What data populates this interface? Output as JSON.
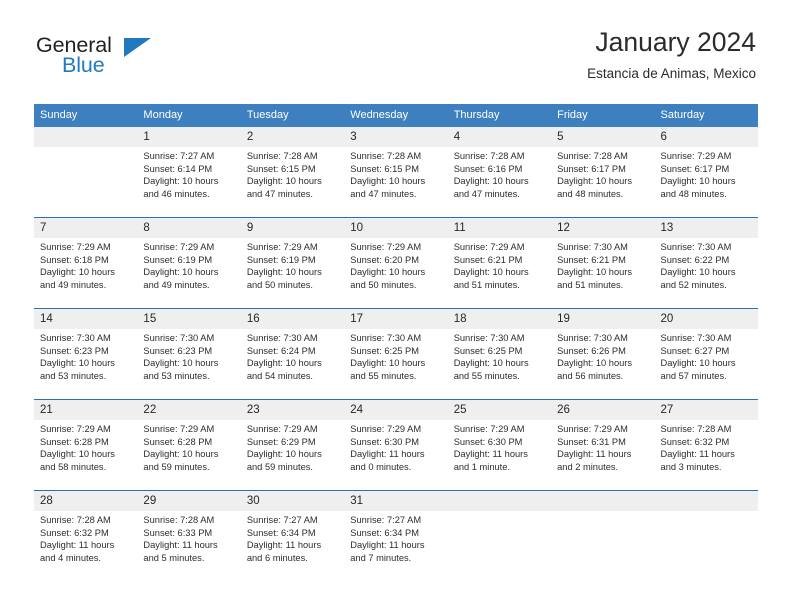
{
  "logo": {
    "word_one": "General",
    "word_two": "Blue",
    "triangle": "triangle-icon",
    "accent_color": "#2179bf"
  },
  "header": {
    "title": "January 2024",
    "subtitle": "Estancia de Animas, Mexico"
  },
  "calendar": {
    "header_bg": "#3d7fbf",
    "daynum_bg": "#efefef",
    "weekday_headers": [
      "Sunday",
      "Monday",
      "Tuesday",
      "Wednesday",
      "Thursday",
      "Friday",
      "Saturday"
    ],
    "weeks": [
      [
        {
          "day": "",
          "sunrise": "",
          "sunset": "",
          "daylight1": "",
          "daylight2": ""
        },
        {
          "day": "1",
          "sunrise": "Sunrise: 7:27 AM",
          "sunset": "Sunset: 6:14 PM",
          "daylight1": "Daylight: 10 hours",
          "daylight2": "and 46 minutes."
        },
        {
          "day": "2",
          "sunrise": "Sunrise: 7:28 AM",
          "sunset": "Sunset: 6:15 PM",
          "daylight1": "Daylight: 10 hours",
          "daylight2": "and 47 minutes."
        },
        {
          "day": "3",
          "sunrise": "Sunrise: 7:28 AM",
          "sunset": "Sunset: 6:15 PM",
          "daylight1": "Daylight: 10 hours",
          "daylight2": "and 47 minutes."
        },
        {
          "day": "4",
          "sunrise": "Sunrise: 7:28 AM",
          "sunset": "Sunset: 6:16 PM",
          "daylight1": "Daylight: 10 hours",
          "daylight2": "and 47 minutes."
        },
        {
          "day": "5",
          "sunrise": "Sunrise: 7:28 AM",
          "sunset": "Sunset: 6:17 PM",
          "daylight1": "Daylight: 10 hours",
          "daylight2": "and 48 minutes."
        },
        {
          "day": "6",
          "sunrise": "Sunrise: 7:29 AM",
          "sunset": "Sunset: 6:17 PM",
          "daylight1": "Daylight: 10 hours",
          "daylight2": "and 48 minutes."
        }
      ],
      [
        {
          "day": "7",
          "sunrise": "Sunrise: 7:29 AM",
          "sunset": "Sunset: 6:18 PM",
          "daylight1": "Daylight: 10 hours",
          "daylight2": "and 49 minutes."
        },
        {
          "day": "8",
          "sunrise": "Sunrise: 7:29 AM",
          "sunset": "Sunset: 6:19 PM",
          "daylight1": "Daylight: 10 hours",
          "daylight2": "and 49 minutes."
        },
        {
          "day": "9",
          "sunrise": "Sunrise: 7:29 AM",
          "sunset": "Sunset: 6:19 PM",
          "daylight1": "Daylight: 10 hours",
          "daylight2": "and 50 minutes."
        },
        {
          "day": "10",
          "sunrise": "Sunrise: 7:29 AM",
          "sunset": "Sunset: 6:20 PM",
          "daylight1": "Daylight: 10 hours",
          "daylight2": "and 50 minutes."
        },
        {
          "day": "11",
          "sunrise": "Sunrise: 7:29 AM",
          "sunset": "Sunset: 6:21 PM",
          "daylight1": "Daylight: 10 hours",
          "daylight2": "and 51 minutes."
        },
        {
          "day": "12",
          "sunrise": "Sunrise: 7:30 AM",
          "sunset": "Sunset: 6:21 PM",
          "daylight1": "Daylight: 10 hours",
          "daylight2": "and 51 minutes."
        },
        {
          "day": "13",
          "sunrise": "Sunrise: 7:30 AM",
          "sunset": "Sunset: 6:22 PM",
          "daylight1": "Daylight: 10 hours",
          "daylight2": "and 52 minutes."
        }
      ],
      [
        {
          "day": "14",
          "sunrise": "Sunrise: 7:30 AM",
          "sunset": "Sunset: 6:23 PM",
          "daylight1": "Daylight: 10 hours",
          "daylight2": "and 53 minutes."
        },
        {
          "day": "15",
          "sunrise": "Sunrise: 7:30 AM",
          "sunset": "Sunset: 6:23 PM",
          "daylight1": "Daylight: 10 hours",
          "daylight2": "and 53 minutes."
        },
        {
          "day": "16",
          "sunrise": "Sunrise: 7:30 AM",
          "sunset": "Sunset: 6:24 PM",
          "daylight1": "Daylight: 10 hours",
          "daylight2": "and 54 minutes."
        },
        {
          "day": "17",
          "sunrise": "Sunrise: 7:30 AM",
          "sunset": "Sunset: 6:25 PM",
          "daylight1": "Daylight: 10 hours",
          "daylight2": "and 55 minutes."
        },
        {
          "day": "18",
          "sunrise": "Sunrise: 7:30 AM",
          "sunset": "Sunset: 6:25 PM",
          "daylight1": "Daylight: 10 hours",
          "daylight2": "and 55 minutes."
        },
        {
          "day": "19",
          "sunrise": "Sunrise: 7:30 AM",
          "sunset": "Sunset: 6:26 PM",
          "daylight1": "Daylight: 10 hours",
          "daylight2": "and 56 minutes."
        },
        {
          "day": "20",
          "sunrise": "Sunrise: 7:30 AM",
          "sunset": "Sunset: 6:27 PM",
          "daylight1": "Daylight: 10 hours",
          "daylight2": "and 57 minutes."
        }
      ],
      [
        {
          "day": "21",
          "sunrise": "Sunrise: 7:29 AM",
          "sunset": "Sunset: 6:28 PM",
          "daylight1": "Daylight: 10 hours",
          "daylight2": "and 58 minutes."
        },
        {
          "day": "22",
          "sunrise": "Sunrise: 7:29 AM",
          "sunset": "Sunset: 6:28 PM",
          "daylight1": "Daylight: 10 hours",
          "daylight2": "and 59 minutes."
        },
        {
          "day": "23",
          "sunrise": "Sunrise: 7:29 AM",
          "sunset": "Sunset: 6:29 PM",
          "daylight1": "Daylight: 10 hours",
          "daylight2": "and 59 minutes."
        },
        {
          "day": "24",
          "sunrise": "Sunrise: 7:29 AM",
          "sunset": "Sunset: 6:30 PM",
          "daylight1": "Daylight: 11 hours",
          "daylight2": "and 0 minutes."
        },
        {
          "day": "25",
          "sunrise": "Sunrise: 7:29 AM",
          "sunset": "Sunset: 6:30 PM",
          "daylight1": "Daylight: 11 hours",
          "daylight2": "and 1 minute."
        },
        {
          "day": "26",
          "sunrise": "Sunrise: 7:29 AM",
          "sunset": "Sunset: 6:31 PM",
          "daylight1": "Daylight: 11 hours",
          "daylight2": "and 2 minutes."
        },
        {
          "day": "27",
          "sunrise": "Sunrise: 7:28 AM",
          "sunset": "Sunset: 6:32 PM",
          "daylight1": "Daylight: 11 hours",
          "daylight2": "and 3 minutes."
        }
      ],
      [
        {
          "day": "28",
          "sunrise": "Sunrise: 7:28 AM",
          "sunset": "Sunset: 6:32 PM",
          "daylight1": "Daylight: 11 hours",
          "daylight2": "and 4 minutes."
        },
        {
          "day": "29",
          "sunrise": "Sunrise: 7:28 AM",
          "sunset": "Sunset: 6:33 PM",
          "daylight1": "Daylight: 11 hours",
          "daylight2": "and 5 minutes."
        },
        {
          "day": "30",
          "sunrise": "Sunrise: 7:27 AM",
          "sunset": "Sunset: 6:34 PM",
          "daylight1": "Daylight: 11 hours",
          "daylight2": "and 6 minutes."
        },
        {
          "day": "31",
          "sunrise": "Sunrise: 7:27 AM",
          "sunset": "Sunset: 6:34 PM",
          "daylight1": "Daylight: 11 hours",
          "daylight2": "and 7 minutes."
        },
        {
          "day": "",
          "sunrise": "",
          "sunset": "",
          "daylight1": "",
          "daylight2": ""
        },
        {
          "day": "",
          "sunrise": "",
          "sunset": "",
          "daylight1": "",
          "daylight2": ""
        },
        {
          "day": "",
          "sunrise": "",
          "sunset": "",
          "daylight1": "",
          "daylight2": ""
        }
      ]
    ]
  }
}
